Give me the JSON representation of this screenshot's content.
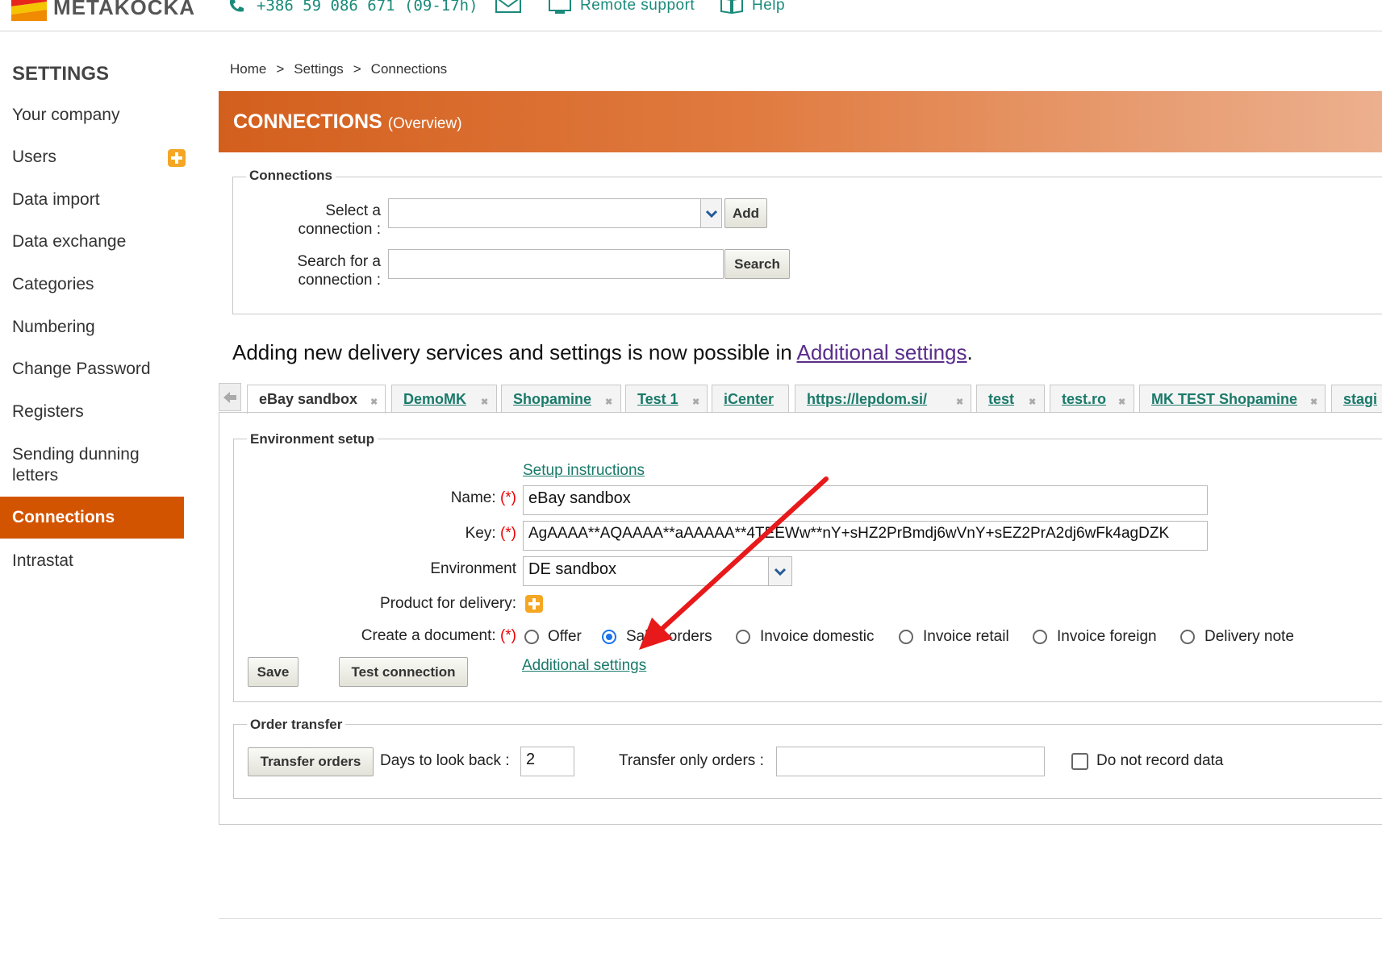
{
  "topbar": {
    "brand": "METAKOCKA",
    "phone": "+386 59 086 671",
    "hours": "(09-17h)",
    "remote_support": "Remote support",
    "help": "Help"
  },
  "sidebar": {
    "title": "SETTINGS",
    "items": [
      {
        "label": "Your company"
      },
      {
        "label": "Users"
      },
      {
        "label": "Data import"
      },
      {
        "label": "Data exchange"
      },
      {
        "label": "Categories"
      },
      {
        "label": "Numbering"
      },
      {
        "label": "Change Password"
      },
      {
        "label": "Registers"
      },
      {
        "label": "Sending dunning"
      },
      {
        "label": "letters"
      },
      {
        "label": "Connections"
      },
      {
        "label": "Intrastat"
      }
    ]
  },
  "breadcrumb": [
    "Home",
    "Settings",
    "Connections"
  ],
  "breadcrumb_sep": ">",
  "header": {
    "title": "CONNECTIONS",
    "subtitle": "(Overview)"
  },
  "connections_box": {
    "legend": "Connections",
    "select_label_1": "Select a",
    "select_label_2": "connection :",
    "select_value": "",
    "add_label": "Add",
    "search_label_1": "Search for a",
    "search_label_2": "connection :",
    "search_value": "",
    "search_button": "Search"
  },
  "notice": {
    "text": "Adding new delivery services and settings is now possible in ",
    "link": "Additional settings",
    "end": "."
  },
  "tabs": [
    "eBay sandbox",
    "DemoMK",
    "Shopamine",
    "Test 1",
    "iCenter",
    "https://lepdom.si/",
    "test",
    "test.ro",
    "MK TEST Shopamine",
    "stagi"
  ],
  "environment": {
    "legend": "Environment setup",
    "setup_link": "Setup instructions",
    "name_label": "Name:",
    "key_label": "Key:",
    "required_mark": "(*)",
    "name_value": "eBay sandbox",
    "key_value": "AgAAAA**AQAAAA**aAAAAA**4TEEWw**nY+sHZ2PrBmdj6wVnY+sEZ2PrA2dj6wFk4agDZK",
    "env_label": "Environment",
    "env_value": "DE sandbox",
    "product_label": "Product for delivery:",
    "create_label": "Create a document:",
    "doc_options": [
      "Offer",
      "Sales orders",
      "Invoice domestic",
      "Invoice retail",
      "Invoice foreign",
      "Delivery note"
    ],
    "selected_option": "Sales orders",
    "save_label": "Save",
    "test_label": "Test connection",
    "additional_link": "Additional settings"
  },
  "order_transfer": {
    "legend": "Order transfer",
    "transfer_button": "Transfer orders",
    "days_label": "Days to look back :",
    "days_value": "2",
    "only_label": "Transfer only orders :",
    "only_value": "",
    "no_record_label": "Do not record data",
    "no_record_checked": false
  },
  "colors": {
    "accent": "#d35400",
    "link": "#1a7a6a",
    "arrow": "#e8191a"
  }
}
